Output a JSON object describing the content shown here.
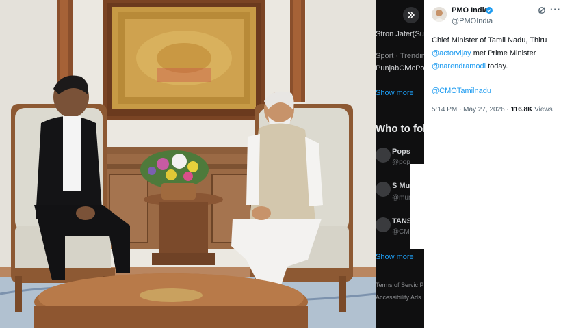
{
  "tweet": {
    "author_name": "PMO India",
    "author_handle": "@PMOIndia",
    "text_line1": "Chief Minister of Tamil Nadu, Thiru",
    "mention1": "@actorvijay",
    "text_line2": " met Prime Minister",
    "mention2": "@narendramodi",
    "text_line3": " today.",
    "mention3": "@CMOTamilnadu",
    "time": "5:14 PM · May 27, 2026 · ",
    "views_count": "116.8K",
    "views_label": " Views"
  },
  "background_page": {
    "item1": "Stron  Jater(Su",
    "item2": "Sport · Trending",
    "item3": "PunjabCivicPol",
    "show_more": "Show more",
    "who_to_follow": "Who to follo",
    "follow1_name": "Pops",
    "follow1_handle": "@pop",
    "follow2_name": "S Muru",
    "follow2_handle": "@mure",
    "follow3_name": "TANSI",
    "follow3_handle": "@CMC",
    "show_more2": "Show more",
    "footer1": "Terms of Servic  Pri",
    "footer2": "Accessibility  Ads"
  },
  "icons": {
    "expand": "double-chevron-right-icon",
    "verified": "verified-badge-icon",
    "grok": "grok-icon",
    "more": "more-horizontal-icon"
  },
  "colors": {
    "link": "#1d9bf0",
    "text": "#0f1419",
    "secondary": "#536471",
    "dark_bg": "#0f0f10"
  }
}
